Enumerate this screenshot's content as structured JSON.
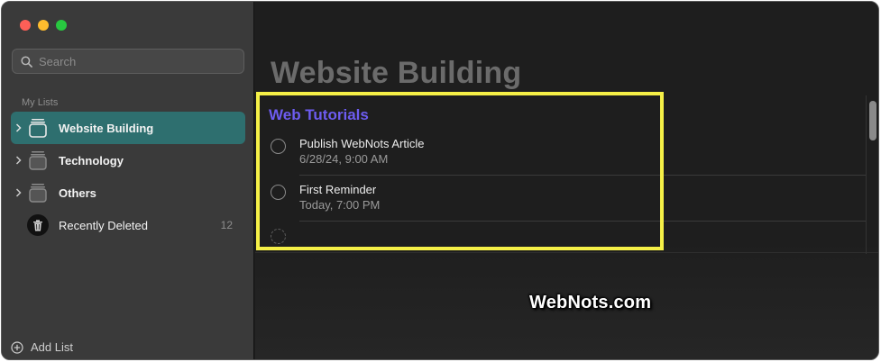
{
  "sidebar": {
    "search": {
      "placeholder": "Search"
    },
    "section_title": "My Lists",
    "lists": [
      {
        "label": "Website Building",
        "selected": true
      },
      {
        "label": "Technology",
        "selected": false
      },
      {
        "label": "Others",
        "selected": false
      }
    ],
    "recently_deleted": {
      "label": "Recently Deleted",
      "count": "12"
    },
    "add_list": "Add List"
  },
  "main": {
    "title": "Website Building",
    "group_title": "Web Tutorials",
    "reminders": [
      {
        "title": "Publish WebNots Article",
        "date": "6/28/24, 9:00 AM"
      },
      {
        "title": "First Reminder",
        "date": "Today, 7:00 PM"
      }
    ]
  },
  "watermark": "WebNots.com",
  "colors": {
    "selected_list": "#2e6f6f",
    "group_title": "#6d5cf0",
    "highlight": "#f5f047"
  }
}
